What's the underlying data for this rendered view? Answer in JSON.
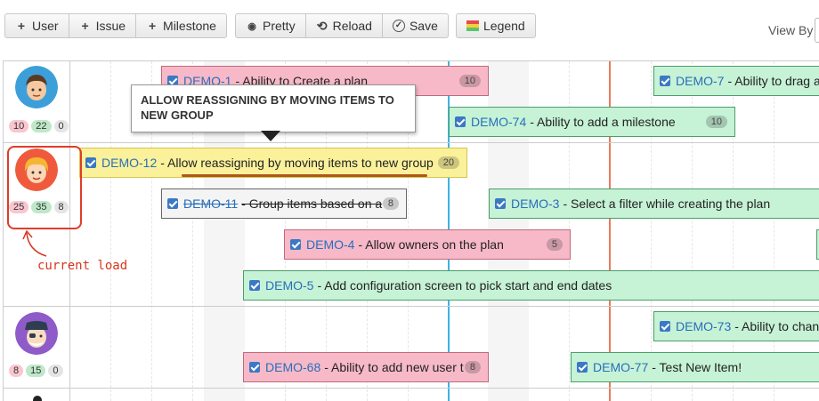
{
  "toolbar": {
    "add_user": "User",
    "add_issue": "Issue",
    "add_milestone": "Milestone",
    "pretty": "Pretty",
    "reload": "Reload",
    "save": "Save",
    "legend": "Legend",
    "view_by": "View By"
  },
  "icons": {
    "plus": "+",
    "eye": "◉",
    "reload": "⟲",
    "save": "✓"
  },
  "colors": {
    "pink_card": "#f7b9c8",
    "green_card": "#c6f2d6",
    "yellow_card": "#fbf19a",
    "today_line": "#3bb4e5",
    "deadline_line": "#e87a5d",
    "annotation": "#d8361f"
  },
  "users": [
    {
      "counts": [
        "10",
        "22",
        "0"
      ]
    },
    {
      "counts": [
        "25",
        "35",
        "8"
      ]
    },
    {
      "counts": [
        "8",
        "15",
        "0"
      ]
    }
  ],
  "cards": {
    "demo1": {
      "key": "DEMO-1",
      "title": " - Ability to Create a plan",
      "points": "10"
    },
    "demo7": {
      "key": "DEMO-7",
      "title": " - Ability to drag a",
      "points": ""
    },
    "demo74": {
      "key": "DEMO-74",
      "title": " - Ability to add a milestone",
      "points": "10"
    },
    "demo12": {
      "key": "DEMO-12",
      "title": " - Allow reassigning by moving items to new group",
      "points": "20"
    },
    "demo11": {
      "key": "DEMO-11",
      "title": " - Group items based on a",
      "points": "8"
    },
    "demo3": {
      "key": "DEMO-3",
      "title": " - Select a filter while creating the plan",
      "points": ""
    },
    "demo4": {
      "key": "DEMO-4",
      "title": " - Allow owners on the plan",
      "points": "5"
    },
    "demo5": {
      "key": "DEMO-5",
      "title": " - Add configuration screen to pick start and end dates",
      "points": ""
    },
    "demo73": {
      "key": "DEMO-73",
      "title": " - Ability to chan",
      "points": ""
    },
    "demo68": {
      "key": "DEMO-68",
      "title": " - Ability to add new user t",
      "points": "8"
    },
    "demo77": {
      "key": "DEMO-77",
      "title": " - Test New Item!",
      "points": ""
    }
  },
  "tooltip": {
    "text": "ALLOW REASSIGNING BY MOVING ITEMS TO NEW GROUP"
  },
  "annotation": {
    "text": "current load"
  }
}
